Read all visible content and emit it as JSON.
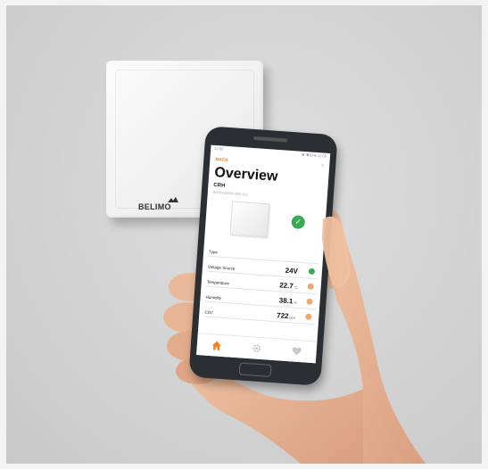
{
  "sensor": {
    "brand": "BELIMO"
  },
  "app": {
    "status_bar": {
      "left": "12:05",
      "right": "✱ ◥ 92% 12:05"
    },
    "back_label": "BACK",
    "close_label": "×",
    "title": "Overview",
    "subtitle": "CRH",
    "serial": "00000-00000-000-012",
    "status_ok": "✓",
    "rows": [
      {
        "label": "Type",
        "value": "",
        "unit": "",
        "indicator": ""
      },
      {
        "label": "Voltage Source",
        "value": "24V",
        "unit": "",
        "indicator": "green"
      },
      {
        "label": "Temperature",
        "value": "22.7",
        "unit": "°C",
        "indicator": "orange"
      },
      {
        "label": "Humidity",
        "value": "38.1",
        "unit": "%",
        "indicator": "orange"
      },
      {
        "label": "CO2",
        "value": "722",
        "unit": "ppm",
        "indicator": "orange"
      }
    ],
    "tabs": [
      "home-icon",
      "gear-icon",
      "heart-icon"
    ],
    "colors": {
      "accent": "#f08020",
      "ok": "#3aab55",
      "warn": "#f3a86b"
    }
  }
}
